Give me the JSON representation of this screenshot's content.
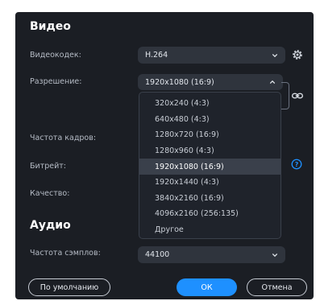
{
  "video": {
    "title": "Видео",
    "codec_label": "Видеокодек:",
    "codec_value": "H.264",
    "resolution_label": "Разрешение:",
    "resolution_value": "1920x1080 (16:9)",
    "framerate_label": "Частота кадров:",
    "bitrate_label": "Битрейт:",
    "quality_label": "Качество:"
  },
  "resolution_options": [
    "320x240 (4:3)",
    "640x480 (4:3)",
    "1280x720 (16:9)",
    "1280x960 (4:3)",
    "1920x1080 (16:9)",
    "1920x1440 (4:3)",
    "3840x2160 (16:9)",
    "4096x2160 (256:135)",
    "Другое"
  ],
  "selected_resolution_index": 4,
  "audio": {
    "title": "Аудио",
    "samplerate_label": "Частота сэмплов:",
    "samplerate_value": "44100"
  },
  "buttons": {
    "default_label": "По умолчанию",
    "ok_label": "ОК",
    "cancel_label": "Отмена"
  },
  "colors": {
    "background": "#1b1e24",
    "field": "#2f343d",
    "accent": "#1e90ff"
  },
  "icons": {
    "settings": "gear-icon",
    "link": "link-icon",
    "help": "help-icon",
    "dropdown": "chevron-down-icon",
    "dropdown_open": "chevron-up-icon"
  }
}
